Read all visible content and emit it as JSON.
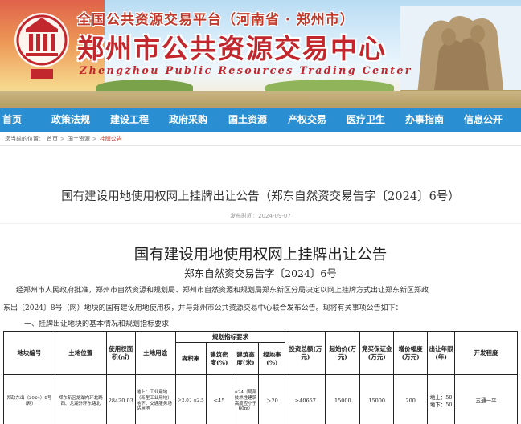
{
  "banner": {
    "subtitle": "全国公共资源交易平台（河南省 · 郑州市）",
    "title": "郑州市公共资源交易中心",
    "title_en": "Zhengzhou Public Resources Trading Center"
  },
  "nav": {
    "items": [
      {
        "label": "首页"
      },
      {
        "label": "政策法规"
      },
      {
        "label": "建设工程"
      },
      {
        "label": "政府采购"
      },
      {
        "label": "国土资源"
      },
      {
        "label": "产权交易"
      },
      {
        "label": "医疗卫生"
      },
      {
        "label": "办事指南"
      },
      {
        "label": "信息公开"
      }
    ],
    "bg_color": "#2a8fd2"
  },
  "breadcrumb": {
    "prefix": "您当前的位置：",
    "items": [
      "首页",
      "国土资源",
      "挂牌公告"
    ],
    "separator": ">"
  },
  "article": {
    "title": "国有建设用地使用权网上挂牌出让公告（郑东自然资交易告字〔2024〕6号）",
    "date": "发布时间：2024-09-07",
    "doc_title": "国有建设用地使用权网上挂牌出让公告",
    "doc_no": "郑东自然资交易告字〔2024〕6号",
    "para1": "经郑州市人民政府批准，郑州市自然资源和规划局、郑州市自然资源和规划局郑东新区分局决定以网上挂牌方式出让郑东新区郑政",
    "para2": "东出〔2024〕8号（网）地块的国有建设用地使用权，并与郑州市公共资源交易中心联合发布公告。现将有关事项公告如下：",
    "section1": "一、挂牌出让地块的基本情况和规划指标要求"
  },
  "table": {
    "headers": {
      "parcel_no": "地块编号",
      "location": "土地位置",
      "area": "使用权面积(㎡)",
      "use": "土地用途",
      "plan_group": "规划指标要求",
      "far": "容积率",
      "density": "建筑密度(%)",
      "height": "建筑高度(米)",
      "green": "绿地率(%)",
      "investment": "投资总额(万元)",
      "start_price": "起始价(万元)",
      "deposit": "竞买保证金(万元)",
      "increment": "增价幅度(万元)",
      "term": "出让年限(年)",
      "dev_level": "开发程度"
    },
    "rows": [
      {
        "parcel_no": "郑政东出（2024）8号（网）",
        "location": "郑东新区龙湖内环北路西、龙湖外环东路北",
        "area": "28420.03",
        "use": "地上：工业用地（新型工业用地）地下：交通服务场站用地",
        "far": "＞2.0；≤2.5",
        "density": "≤45",
        "height": "≤24（局部技术性建筑高度应小于60m）",
        "green": "＞20",
        "investment": "≥40657",
        "start_price": "15000",
        "deposit": "15000",
        "increment": "200",
        "term": "地上：50 地下：50",
        "dev_level": "五通一平"
      }
    ]
  }
}
